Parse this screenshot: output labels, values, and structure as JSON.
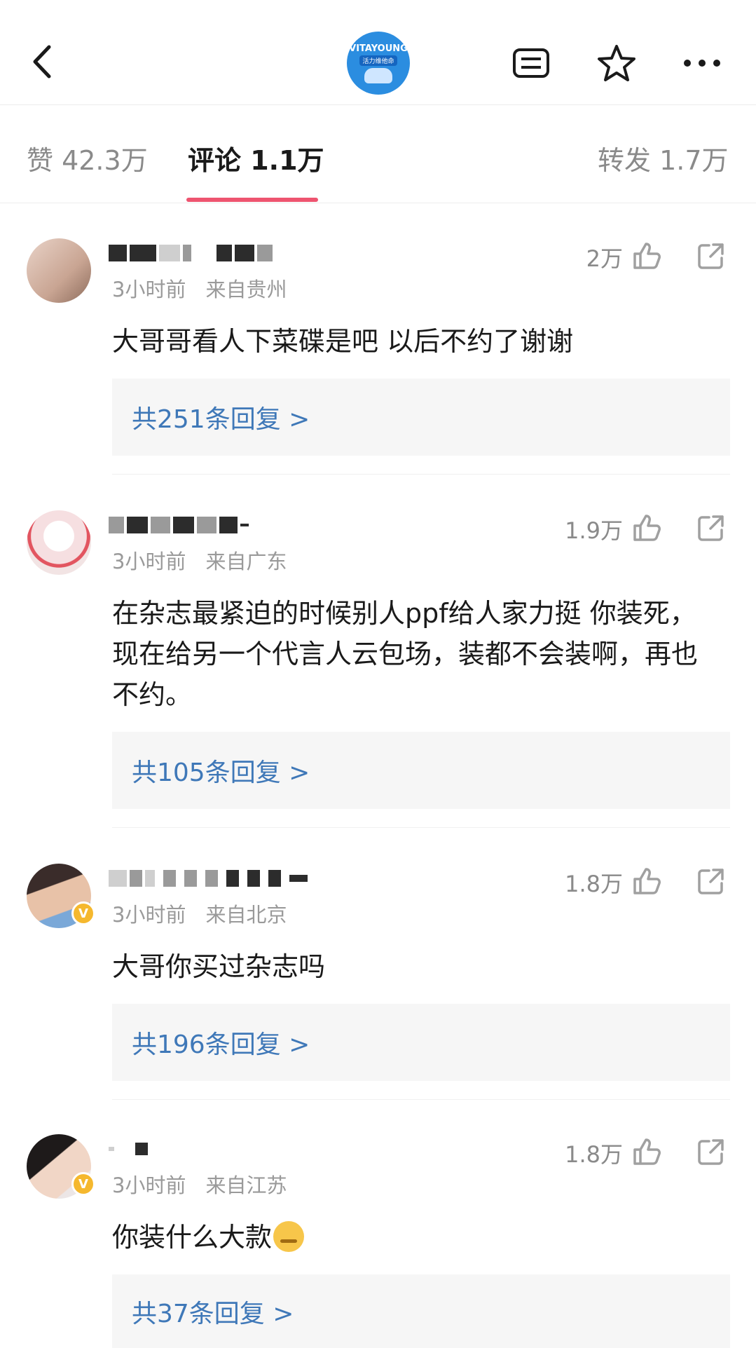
{
  "header": {
    "logo_line1": "VITAYOUNG",
    "logo_line2": "活力维他命"
  },
  "tabs": [
    {
      "label": "赞 42.3万"
    },
    {
      "label": "评论 1.1万"
    },
    {
      "label": "转发 1.7万"
    }
  ],
  "comments": [
    {
      "time": "3小时前",
      "location": "来自贵州",
      "likes": "2万",
      "text": "大哥哥看人下菜碟是吧 以后不约了谢谢",
      "replies": "共251条回复 >"
    },
    {
      "time": "3小时前",
      "location": "来自广东",
      "likes": "1.9万",
      "text": "在杂志最紧迫的时候别人ppf给人家力挺 你装死，现在给另一个代言人云包场，装都不会装啊，再也不约。",
      "replies": "共105条回复 >"
    },
    {
      "time": "3小时前",
      "location": "来自北京",
      "likes": "1.8万",
      "text": "大哥你买过杂志吗",
      "replies": "共196条回复 >"
    },
    {
      "time": "3小时前",
      "location": "来自江苏",
      "likes": "1.8万",
      "text": "你装什么大款",
      "replies": "共37条回复 >"
    }
  ],
  "colors": {
    "accent": "#ee5470",
    "link": "#3f78b8",
    "verified": "#f5b82e"
  }
}
